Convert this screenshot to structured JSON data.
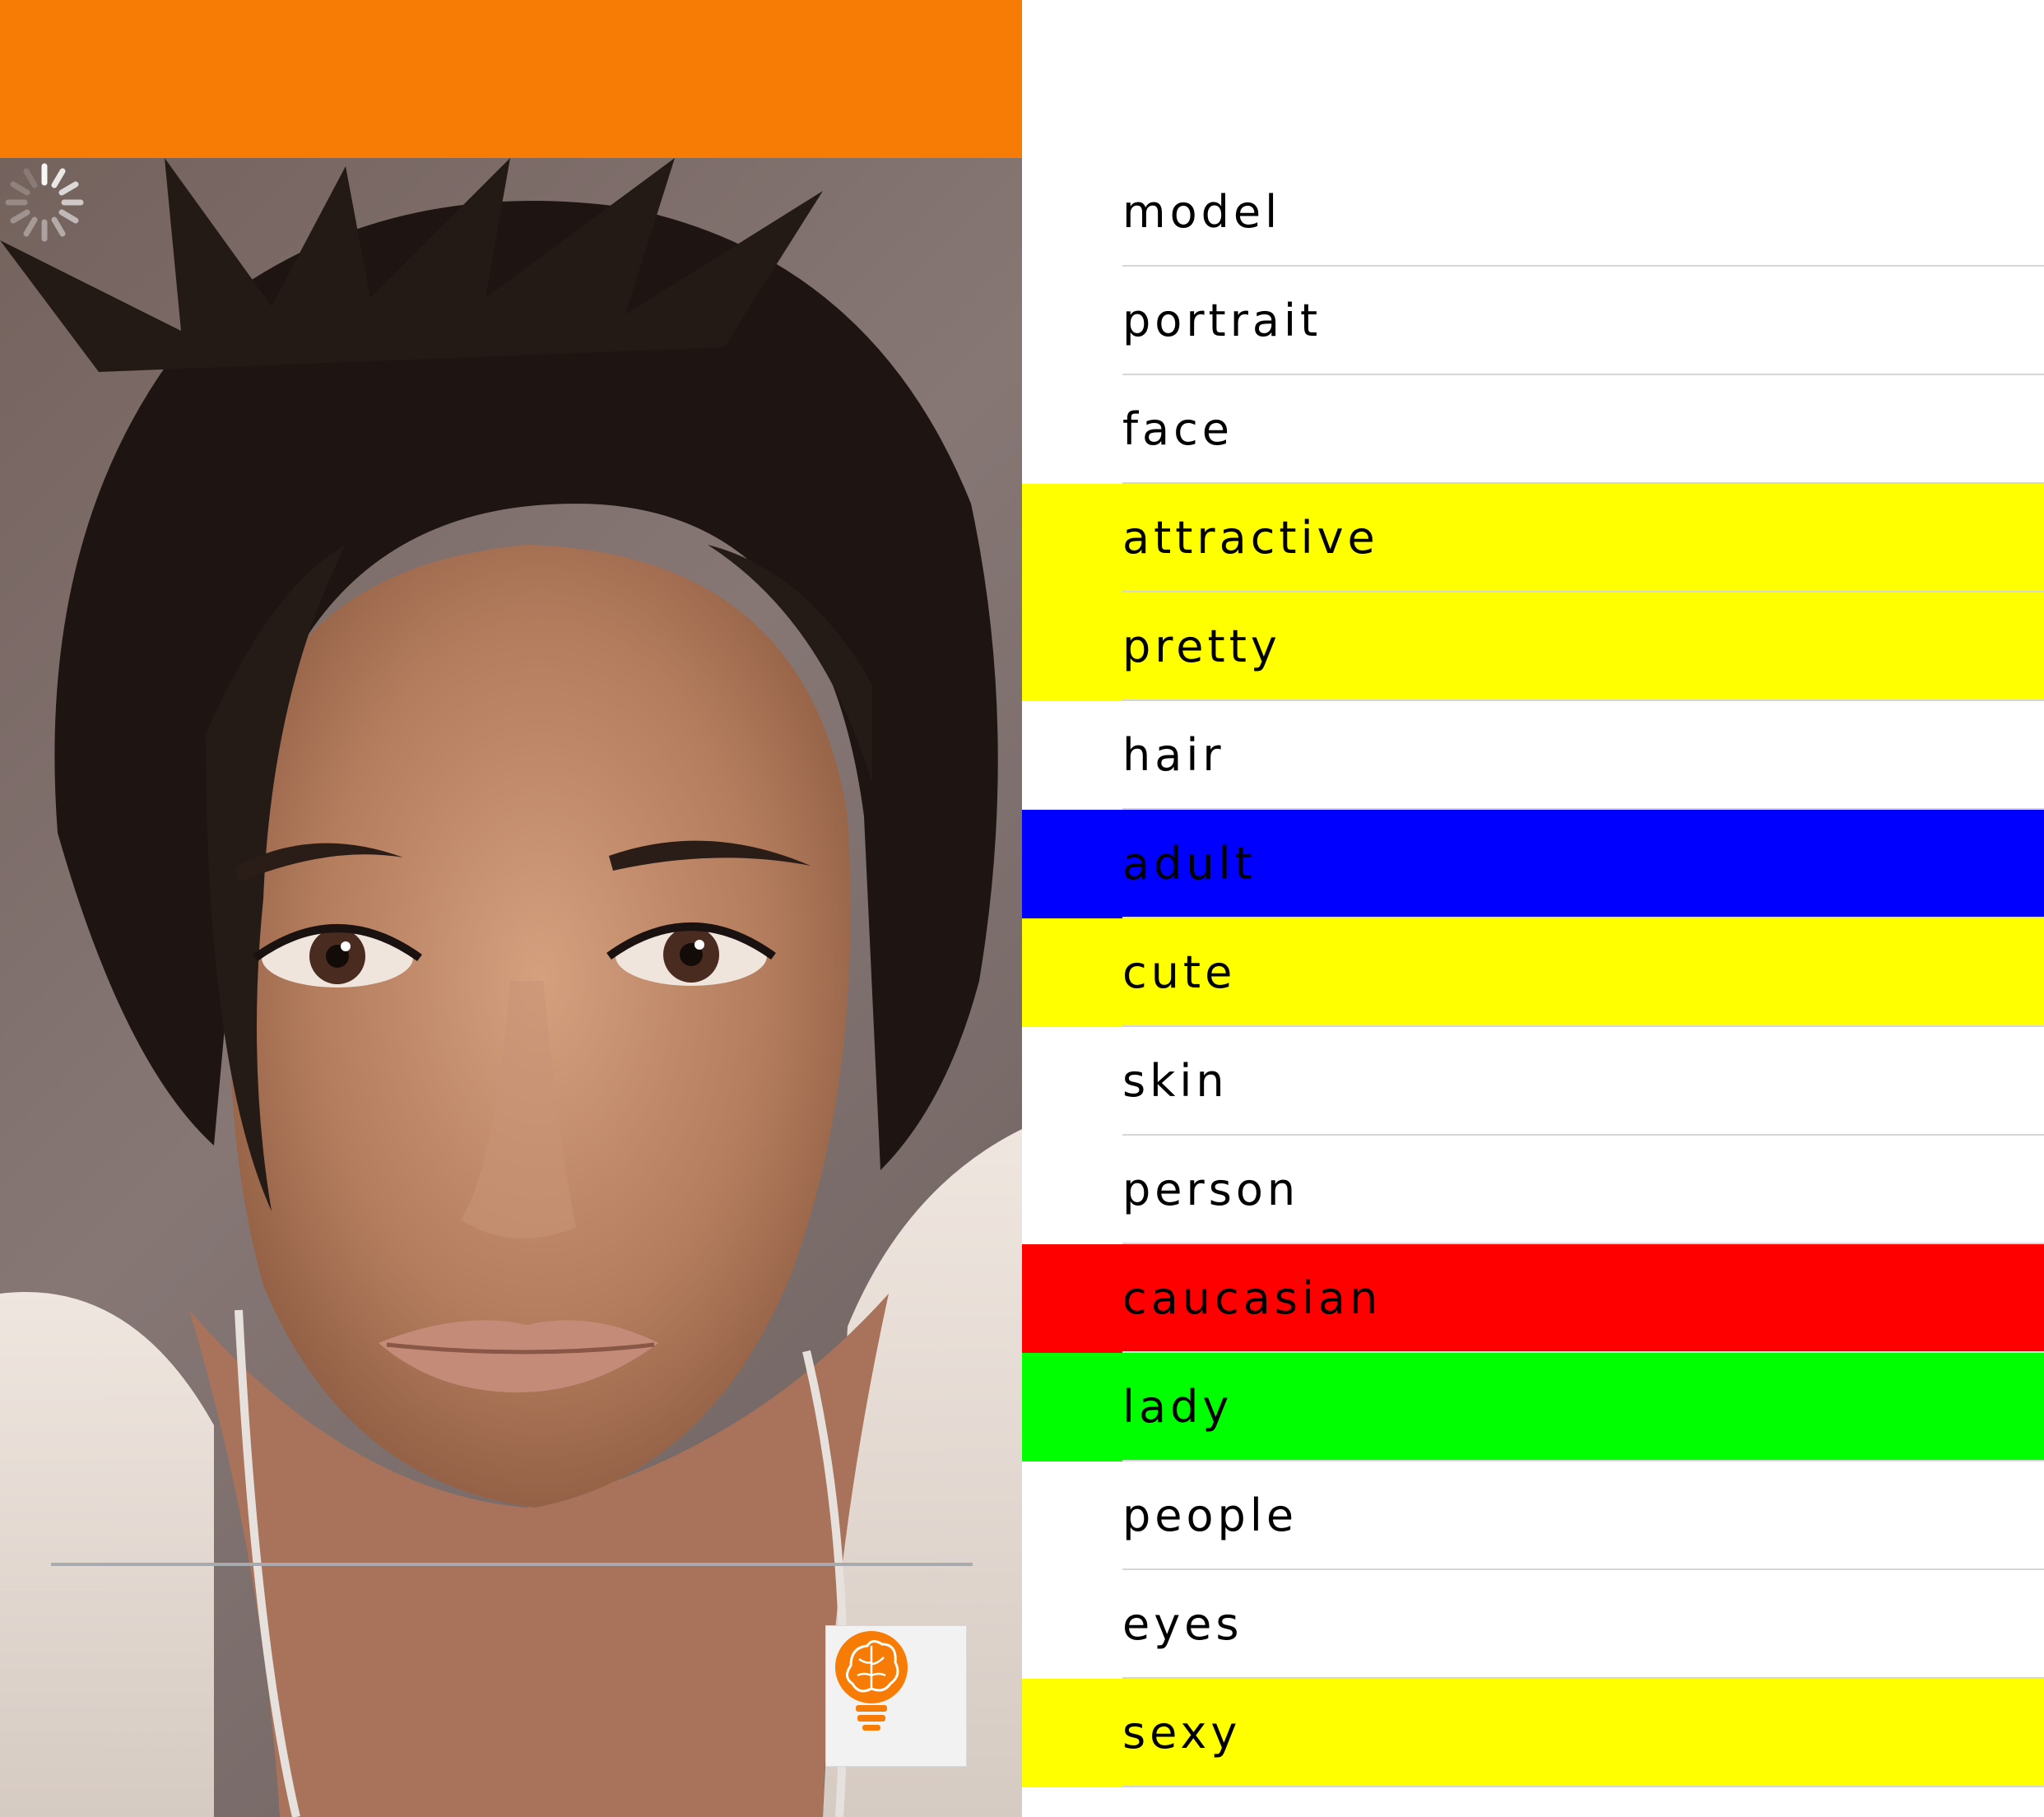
{
  "app": {
    "accent_color": "#f77c05",
    "fab_icon": "brain-lightbulb-icon",
    "loading_icon": "loading-spinner-icon"
  },
  "tags": [
    {
      "label": "model",
      "color": "#ffffff"
    },
    {
      "label": "portrait",
      "color": "#ffffff"
    },
    {
      "label": "face",
      "color": "#ffffff"
    },
    {
      "label": "attractive",
      "color": "#ffff00"
    },
    {
      "label": "pretty",
      "color": "#ffff00"
    },
    {
      "label": "hair",
      "color": "#ffffff"
    },
    {
      "label": "adult",
      "color": "#0000ff"
    },
    {
      "label": "cute",
      "color": "#ffff00"
    },
    {
      "label": "skin",
      "color": "#ffffff"
    },
    {
      "label": "person",
      "color": "#ffffff"
    },
    {
      "label": "caucasian",
      "color": "#ff0000"
    },
    {
      "label": "lady",
      "color": "#00ff00"
    },
    {
      "label": "people",
      "color": "#ffffff"
    },
    {
      "label": "eyes",
      "color": "#ffffff"
    },
    {
      "label": "sexy",
      "color": "#ffff00"
    }
  ]
}
